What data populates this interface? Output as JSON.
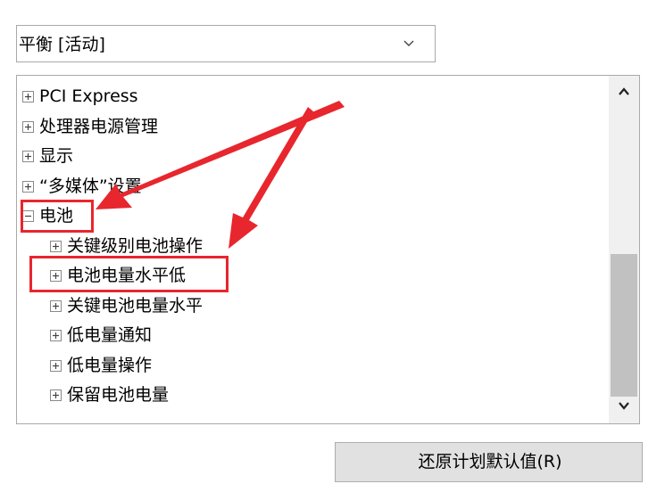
{
  "power_plan": {
    "selected": "平衡 [活动]",
    "chevron_icon": "chevron-down-icon"
  },
  "tree": {
    "expander_collapsed_icon": "plus-box-icon",
    "expander_expanded_icon": "minus-box-icon",
    "items": [
      {
        "label": "PCI Express",
        "level": 0,
        "state": "collapsed"
      },
      {
        "label": "处理器电源管理",
        "level": 0,
        "state": "collapsed"
      },
      {
        "label": "显示",
        "level": 0,
        "state": "collapsed"
      },
      {
        "label": "“多媒体”设置",
        "level": 0,
        "state": "collapsed"
      },
      {
        "label": "电池",
        "level": 0,
        "state": "expanded"
      },
      {
        "label": "关键级别电池操作",
        "level": 1,
        "state": "collapsed"
      },
      {
        "label": "电池电量水平低",
        "level": 1,
        "state": "collapsed"
      },
      {
        "label": "关键电池电量水平",
        "level": 1,
        "state": "collapsed"
      },
      {
        "label": "低电量通知",
        "level": 1,
        "state": "collapsed"
      },
      {
        "label": "低电量操作",
        "level": 1,
        "state": "collapsed"
      },
      {
        "label": "保留电池电量",
        "level": 1,
        "state": "collapsed"
      }
    ]
  },
  "scrollbar": {
    "up_icon": "scroll-up-icon",
    "down_icon": "scroll-down-icon"
  },
  "restore_button": {
    "label": "还原计划默认值(R)"
  },
  "annotations": {
    "highlight_color": "#e8262d",
    "arrow_color": "#e8262d"
  }
}
